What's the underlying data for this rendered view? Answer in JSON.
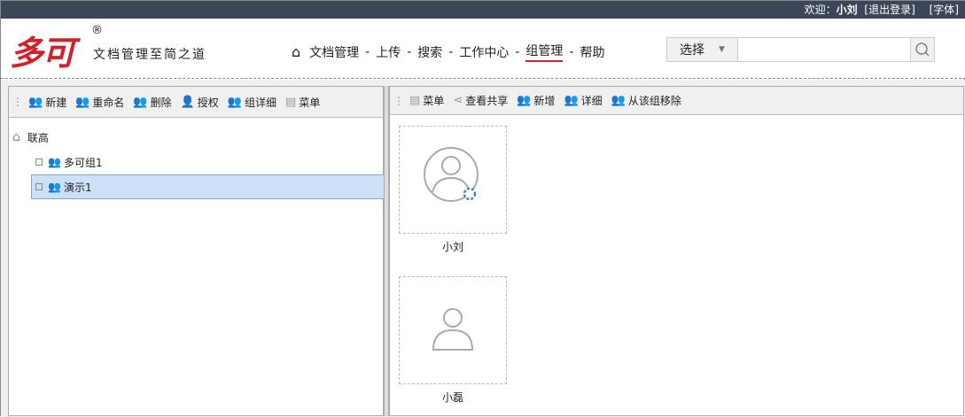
{
  "topbar": {
    "welcome": "欢迎：",
    "user": "小刘",
    "logout": "[退出登录]",
    "font": "[字体]"
  },
  "brand": {
    "logo": "多可",
    "reg": "®",
    "slogan": "文档管理至简之道"
  },
  "nav": {
    "items": [
      "文档管理",
      "上传",
      "搜索",
      "工作中心",
      "组管理",
      "帮助"
    ],
    "active": "组管理"
  },
  "search": {
    "select": "选择",
    "value": "",
    "placeholder": ""
  },
  "left_toolbar": [
    "新建",
    "重命名",
    "删除",
    "授权",
    "组详细",
    "菜单"
  ],
  "tree": {
    "root": "联高",
    "children": [
      "多可组1",
      "演示1"
    ],
    "selected": "演示1"
  },
  "right_toolbar": [
    "菜单",
    "查看共享",
    "新增",
    "详细",
    "从该组移除"
  ],
  "members": [
    {
      "name": "小刘",
      "admin": true
    },
    {
      "name": "小磊",
      "admin": false
    }
  ]
}
